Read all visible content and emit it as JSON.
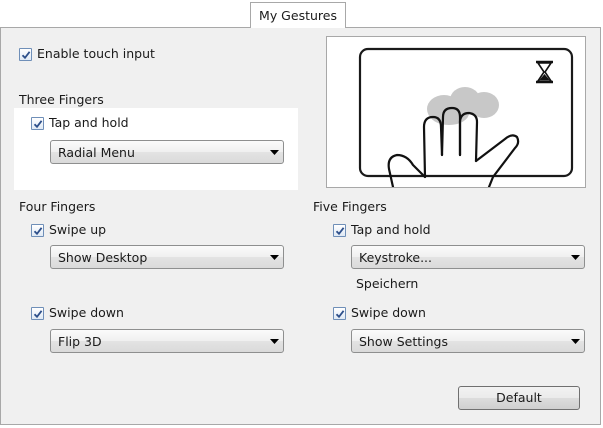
{
  "tab": {
    "label": "My Gestures"
  },
  "enable_touch": {
    "label": "Enable touch input",
    "checked": true
  },
  "three_fingers": {
    "title": "Three Fingers",
    "tap_hold": {
      "label": "Tap and hold",
      "checked": true,
      "action": "Radial Menu"
    }
  },
  "four_fingers": {
    "title": "Four Fingers",
    "swipe_up": {
      "label": "Swipe up",
      "checked": true,
      "action": "Show Desktop"
    },
    "swipe_down": {
      "label": "Swipe down",
      "checked": true,
      "action": "Flip 3D"
    }
  },
  "five_fingers": {
    "title": "Five Fingers",
    "tap_hold": {
      "label": "Tap and hold",
      "checked": true,
      "action": "Keystroke...",
      "note": "Speichern"
    },
    "swipe_down": {
      "label": "Swipe down",
      "checked": true,
      "action": "Show Settings"
    }
  },
  "preview": {
    "icons": [
      "hourglass-icon",
      "hand-icon"
    ]
  },
  "buttons": {
    "default_label": "Default"
  },
  "icons": {
    "checkbox": "checkmark-icon",
    "dropdown": "dropdown-arrow-icon"
  }
}
